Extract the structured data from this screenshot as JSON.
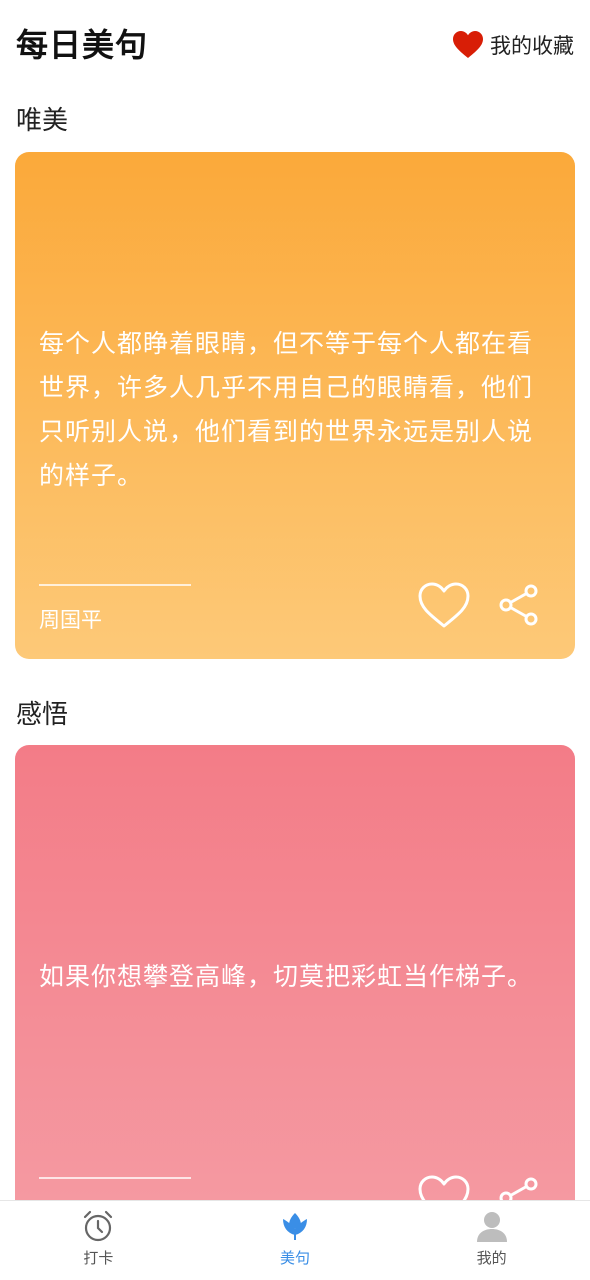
{
  "header": {
    "title": "每日美句",
    "favorites_label": "我的收藏",
    "favorites_icon": "heart-filled-icon",
    "favorites_icon_color": "#d81e06"
  },
  "sections": [
    {
      "heading": "唯美",
      "quote": "每个人都睁着眼睛，但不等于每个人都在看世界，许多人几乎不用自己的眼睛看，他们只听别人说，他们看到的世界永远是别人说的样子。",
      "author": "周国平",
      "colors": [
        "#fba93a",
        "#fdc978"
      ],
      "like_icon": "heart-outline-icon",
      "share_icon": "share-icon"
    },
    {
      "heading": "感悟",
      "quote": "如果你想攀登高峰，切莫把彩虹当作梯子。",
      "colors": [
        "#f37c87",
        "#f59aa2"
      ],
      "like_icon": "heart-outline-icon",
      "share_icon": "share-icon"
    }
  ],
  "tabbar": {
    "items": [
      {
        "label": "打卡",
        "icon": "alarm-clock-icon",
        "active": false
      },
      {
        "label": "美句",
        "icon": "tulip-icon",
        "active": true
      },
      {
        "label": "我的",
        "icon": "user-icon",
        "active": false
      }
    ],
    "active_color": "#3a8ee6",
    "inactive_color": "#666666"
  }
}
